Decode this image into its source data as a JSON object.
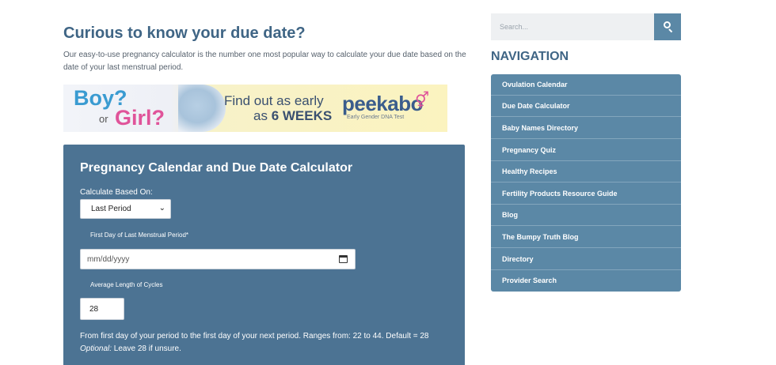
{
  "main": {
    "heading": "Curious to know your due date?",
    "intro": "Our easy-to-use pregnancy calculator is the number one most popular way to calculate your due date based on the date of your last menstrual period."
  },
  "banner": {
    "boy": "Boy?",
    "or": "or",
    "girl": "Girl?",
    "line1": "Find out as early",
    "line2_prefix": "as",
    "line2_bold": "6 WEEKS",
    "brand": "peekabo",
    "tagline": "Early Gender DNA Test"
  },
  "calculator": {
    "title": "Pregnancy Calendar and Due Date Calculator",
    "based_on_label": "Calculate Based On:",
    "based_on_value": "Last Period",
    "first_day_label": "First Day of Last Menstrual Period*",
    "date_placeholder": "mm/dd/yyyy",
    "cycle_label": "Average Length of Cycles",
    "cycle_value": "28",
    "help_line1": "From first day of your period to the first day of your next period. Ranges from: 22 to 44. Default = 28",
    "help_optional": "Optional:",
    "help_line2": " Leave 28 if unsure."
  },
  "sidebar": {
    "search_placeholder": "Search...",
    "nav_title": "NAVIGATION",
    "nav_items": [
      "Ovulation Calendar",
      "Due Date Calculator",
      "Baby Names Directory",
      "Pregnancy Quiz",
      "Healthy Recipes",
      "Fertility Products Resource Guide",
      "Blog",
      "The Bumpy Truth Blog",
      "Directory",
      "Provider Search"
    ]
  },
  "icons": {
    "search": "search-icon",
    "calendar": "calendar-icon",
    "select_arrow": "chevron-down-icon",
    "gender": "gender-symbol-icon"
  },
  "colors": {
    "accent": "#3f6585",
    "calculator_bg": "#4c7393",
    "nav_bg": "#5b88a6"
  }
}
